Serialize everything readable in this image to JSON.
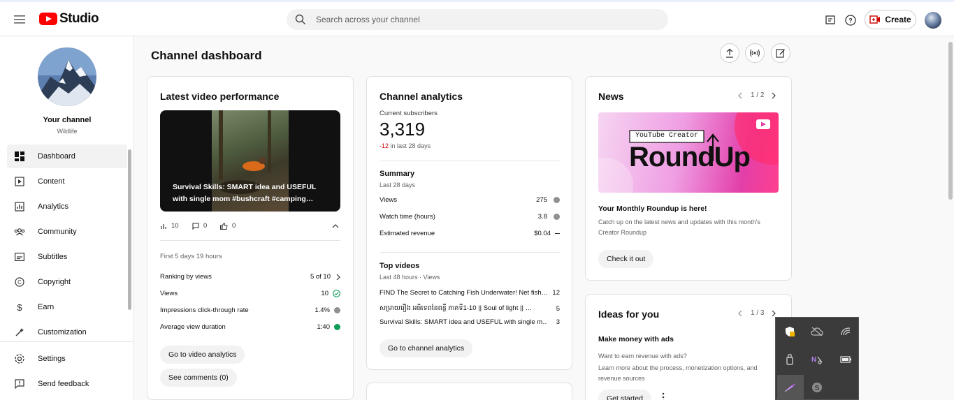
{
  "app": {
    "logo_text": "Studio"
  },
  "search": {
    "placeholder": "Search across your channel"
  },
  "topbar": {
    "create_label": "Create"
  },
  "channel": {
    "name": "Your channel",
    "subtitle": "Wildlife"
  },
  "sidebar": {
    "items": [
      {
        "label": "Dashboard",
        "icon": "dashboard-icon",
        "active": true
      },
      {
        "label": "Content",
        "icon": "content-icon"
      },
      {
        "label": "Analytics",
        "icon": "analytics-icon"
      },
      {
        "label": "Community",
        "icon": "community-icon"
      },
      {
        "label": "Subtitles",
        "icon": "subtitles-icon"
      },
      {
        "label": "Copyright",
        "icon": "copyright-icon"
      },
      {
        "label": "Earn",
        "icon": "earn-icon"
      },
      {
        "label": "Customization",
        "icon": "customization-icon"
      }
    ],
    "bottom": [
      {
        "label": "Settings",
        "icon": "gear-icon"
      },
      {
        "label": "Send feedback",
        "icon": "feedback-icon"
      }
    ]
  },
  "page": {
    "title": "Channel dashboard"
  },
  "latest": {
    "title": "Latest video performance",
    "video_title": "Survival Skills: SMART idea and USEFUL with single mom #bushcraft #camping…",
    "views_count": "10",
    "comments_count": "0",
    "likes_count": "0",
    "period": "First 5 days 19 hours",
    "rows": [
      {
        "label": "Ranking by views",
        "value": "5 of 10"
      },
      {
        "label": "Views",
        "value": "10"
      },
      {
        "label": "Impressions click-through rate",
        "value": "1.4%"
      },
      {
        "label": "Average view duration",
        "value": "1:40"
      }
    ],
    "btn_analytics": "Go to video analytics",
    "btn_comments": "See comments (0)"
  },
  "analytics": {
    "title": "Channel analytics",
    "subs_label": "Current subscribers",
    "subs_value": "3,319",
    "subs_delta": "-12",
    "subs_delta_suffix": "in last 28 days",
    "summary_title": "Summary",
    "summary_period": "Last 28 days",
    "summary_rows": [
      {
        "label": "Views",
        "value": "275"
      },
      {
        "label": "Watch time (hours)",
        "value": "3.8"
      },
      {
        "label": "Estimated revenue",
        "value": "$0.04"
      }
    ],
    "top_title": "Top videos",
    "top_period": "Last 48 hours · Views",
    "top_rows": [
      {
        "label": "FIND The Secret to Catching Fish Underwater! Net fish…",
        "value": "12"
      },
      {
        "label": "សម្រាយរឿង អធិទេពនៃពន្លឺ ភាគទី1-10 || Soul of light || …",
        "value": "5"
      },
      {
        "label": "Survival Skills: SMART idea and USEFUL with single m…",
        "value": "3"
      }
    ],
    "btn": "Go to channel analytics"
  },
  "news": {
    "title": "News",
    "pager": "1 / 2",
    "banner_tag": "YouTube Creator",
    "banner_title": "RoundUp",
    "headline": "Your Monthly Roundup is here!",
    "body": "Catch up on the latest news and updates with this month's Creator Roundup",
    "btn": "Check it out"
  },
  "ideas": {
    "title": "Ideas for you",
    "pager": "1 / 3",
    "headline": "Make money with ads",
    "body1": "Want to earn revenue with ads?",
    "body2": "Learn more about the process, monetization options, and revenue sources",
    "btn": "Get started"
  },
  "colors": {
    "accent_red": "#ff0000",
    "delta_red": "#cc0000",
    "check_green": "#0f9d58"
  }
}
